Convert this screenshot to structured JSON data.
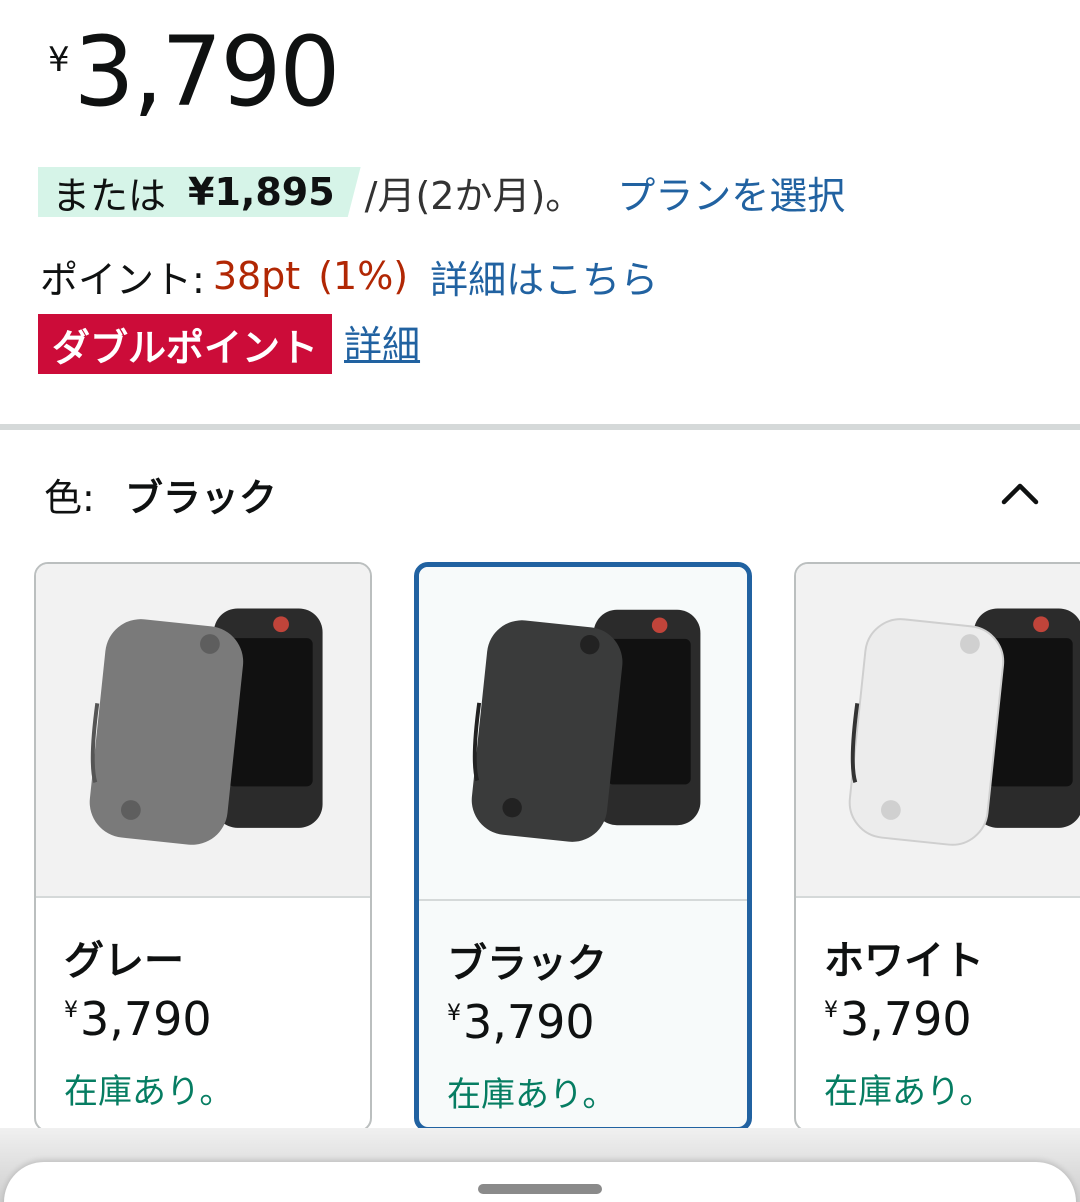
{
  "price": {
    "symbol": "¥",
    "value": "3,790"
  },
  "installment": {
    "prefix": "または",
    "amount": "¥1,895",
    "suffix": "/月(2か月)。",
    "plan_link": "プランを選択"
  },
  "points": {
    "label": "ポイント:",
    "value": "38pt",
    "percent": "(1%)",
    "details_link": "詳細はこちら"
  },
  "double_points": {
    "badge": "ダブルポイント",
    "link": "詳細"
  },
  "color_selector": {
    "label": "色:",
    "selected": "ブラック",
    "expanded": true,
    "chevron_icon": "chevron-up-icon",
    "options": [
      {
        "name": "グレー",
        "price_symbol": "¥",
        "price": "3,790",
        "stock": "在庫あり。",
        "case_color": "#7a7a7a",
        "selected": false
      },
      {
        "name": "ブラック",
        "price_symbol": "¥",
        "price": "3,790",
        "stock": "在庫あり。",
        "case_color": "#3a3b3b",
        "selected": true
      },
      {
        "name": "ホワイト",
        "price_symbol": "¥",
        "price": "3,790",
        "stock": "在庫あり。",
        "case_color": "#ececec",
        "selected": false
      }
    ]
  },
  "colors": {
    "link": "#2162a1",
    "price_red": "#b12704",
    "badge_red": "#cc0c39",
    "stock_green": "#067d62",
    "installment_bg": "#d6f4e8",
    "selected_border": "#2162a1"
  }
}
